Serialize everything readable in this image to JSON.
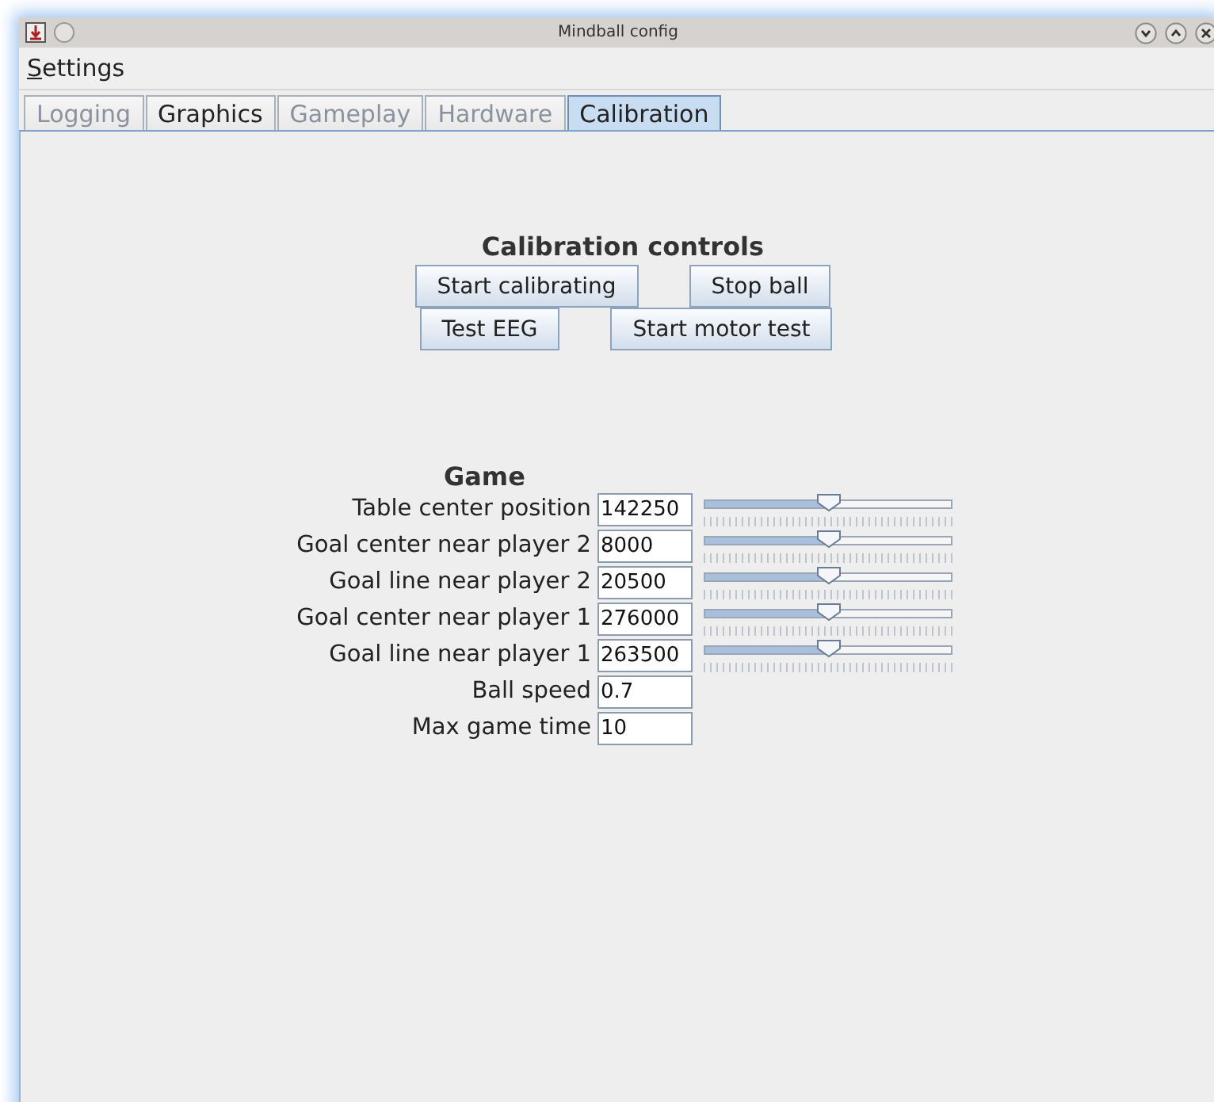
{
  "window": {
    "title": "Mindball config"
  },
  "menu": [
    {
      "label": "Settings"
    }
  ],
  "tabs": [
    {
      "label": "Logging",
      "selected": false,
      "disabled": true
    },
    {
      "label": "Graphics",
      "selected": false,
      "disabled": false
    },
    {
      "label": "Gameplay",
      "selected": false,
      "disabled": true
    },
    {
      "label": "Hardware",
      "selected": false,
      "disabled": true
    },
    {
      "label": "Calibration",
      "selected": true,
      "disabled": false
    }
  ],
  "calibration_controls": {
    "title": "Calibration controls",
    "button_rows": [
      [
        "Start calibrating",
        "Stop ball"
      ],
      [
        "Test EEG",
        "Start motor test"
      ]
    ]
  },
  "game": {
    "title": "Game",
    "rows": [
      {
        "kind": "slider",
        "label": "Table center position",
        "value": "142250",
        "level": 0.5
      },
      {
        "kind": "slider",
        "label": "Goal center near player 2",
        "value": "8000",
        "level": 0.5
      },
      {
        "kind": "slider",
        "label": "Goal line near player 2",
        "value": "20500",
        "level": 0.5
      },
      {
        "kind": "slider",
        "label": "Goal center near player 1",
        "value": "276000",
        "level": 0.5
      },
      {
        "kind": "slider",
        "label": "Goal line near player 1",
        "value": "263500",
        "level": 0.5
      },
      {
        "kind": "field",
        "label": "Ball speed",
        "value": "0.7"
      },
      {
        "kind": "field",
        "label": "Max game time",
        "value": "10"
      }
    ]
  }
}
